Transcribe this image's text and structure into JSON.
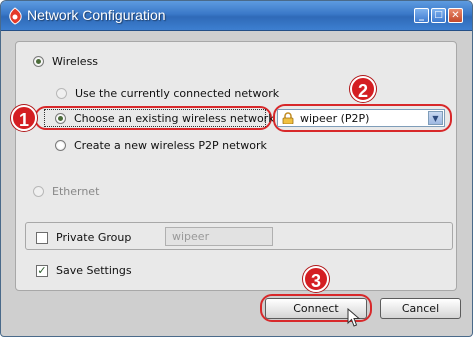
{
  "window": {
    "title": "Network Configuration",
    "controls": {
      "minimize": "_",
      "maximize": "□",
      "close": "✕"
    }
  },
  "connection": {
    "wireless_label": "Wireless",
    "wireless_selected": true,
    "use_current_label": "Use the currently connected network",
    "choose_existing_label": "Choose an existing wireless network",
    "choose_existing_selected": true,
    "create_p2p_label": "Create a new wireless P2P network",
    "ethernet_label": "Ethernet",
    "network_select": {
      "value": "wipeer (P2P)",
      "icon": "lock-icon"
    }
  },
  "group": {
    "private_label": "Private Group",
    "private_checked": false,
    "name_value": "wipeer"
  },
  "save_settings": {
    "label": "Save Settings",
    "checked": true
  },
  "buttons": {
    "connect": "Connect",
    "cancel": "Cancel"
  },
  "annotations": {
    "step1": "1",
    "step2": "2",
    "step3": "3"
  },
  "colors": {
    "annotation_red": "#d41e22",
    "titlebar_blue": "#3a78c8"
  }
}
